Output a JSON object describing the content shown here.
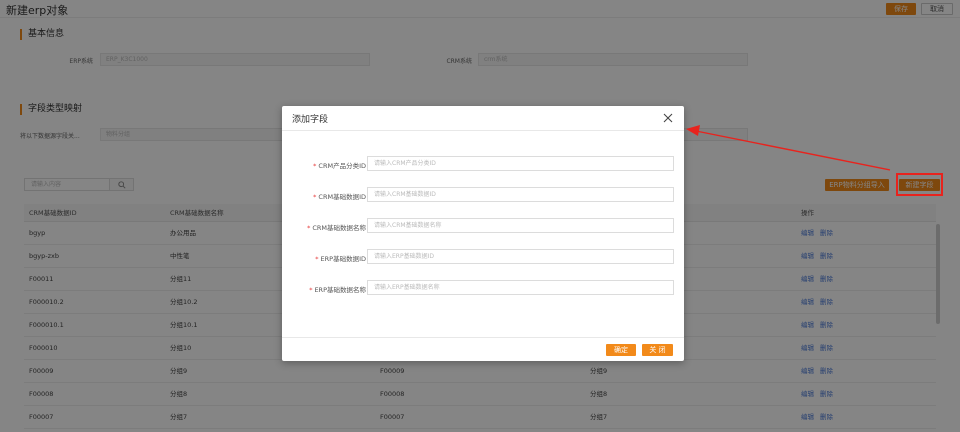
{
  "page": {
    "title": "新建erp对象",
    "save_label": "保存",
    "cancel_label": "取消"
  },
  "basic_info": {
    "title": "基本信息",
    "erp_label": "ERP系统",
    "erp_value": "ERP_K3C1000",
    "crm_label": "CRM系统",
    "crm_value": "crm系统"
  },
  "mapping": {
    "title": "字段类型映射",
    "row_label": "将以下数据源字段关...",
    "row_value": "物料分组",
    "search_placeholder": "请输入内容",
    "erp_import_label": "ERP物料分组导入",
    "new_field_label": "新建字段"
  },
  "table": {
    "columns": [
      "CRM基础数据ID",
      "CRM基础数据名称",
      "",
      "",
      "操作"
    ],
    "edit_label": "编辑",
    "delete_label": "删除",
    "rows": [
      [
        "bgyp",
        "办公用品",
        "",
        ""
      ],
      [
        "bgyp-zxb",
        "中性笔",
        "",
        ""
      ],
      [
        "F00011",
        "分组11",
        "",
        ""
      ],
      [
        "F000010.2",
        "分组10.2",
        "",
        ""
      ],
      [
        "F000010.1",
        "分组10.1",
        "",
        ""
      ],
      [
        "F000010",
        "分组10",
        "",
        ""
      ],
      [
        "F00009",
        "分组9",
        "F00009",
        "分组9"
      ],
      [
        "F00008",
        "分组8",
        "F00008",
        "分组8"
      ],
      [
        "F00007",
        "分组7",
        "F00007",
        "分组7"
      ]
    ]
  },
  "modal": {
    "title": "添加字段",
    "fields": [
      {
        "label": "CRM产品分类ID",
        "placeholder": "请输入CRM产品分类ID"
      },
      {
        "label": "CRM基础数据ID",
        "placeholder": "请输入CRM基础数据ID"
      },
      {
        "label": "CRM基础数据名称",
        "placeholder": "请输入CRM基础数据名称"
      },
      {
        "label": "ERP基础数据ID",
        "placeholder": "请输入ERP基础数据ID"
      },
      {
        "label": "ERP基础数据名称",
        "placeholder": "请输入ERP基础数据名称"
      }
    ],
    "confirm_label": "确定",
    "close_label": "关 闭"
  },
  "colors": {
    "accent": "#f28a1a",
    "link": "#4a7ad8",
    "annotation": "#e8231d"
  }
}
